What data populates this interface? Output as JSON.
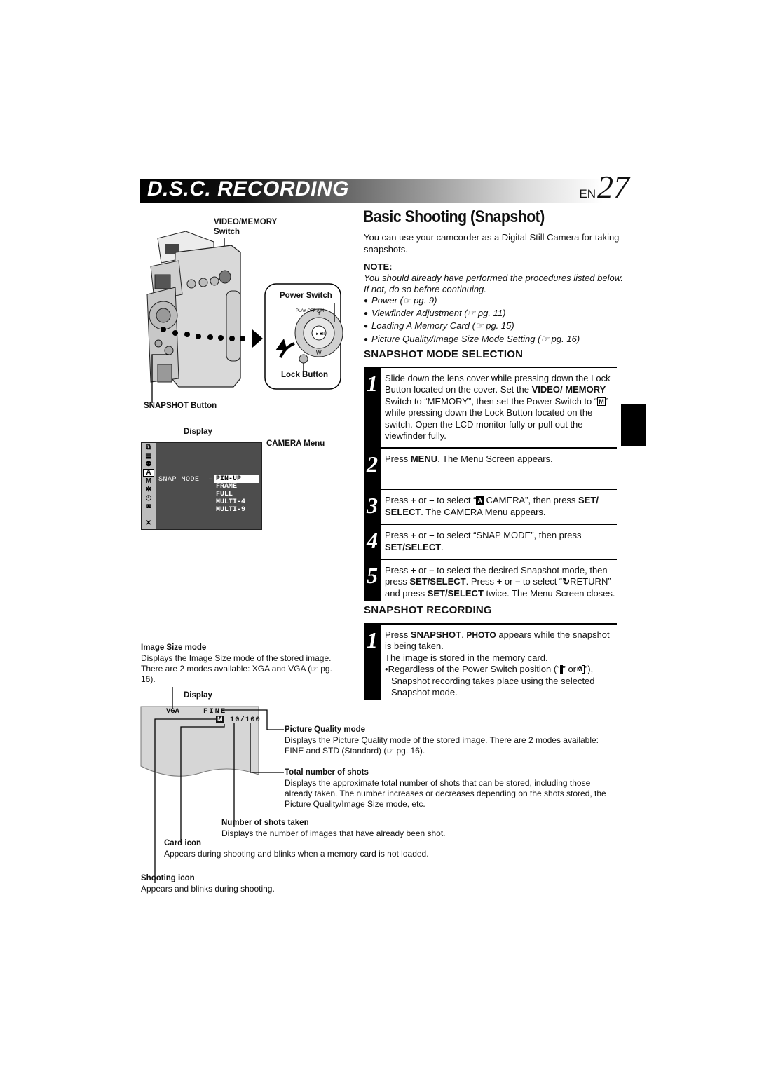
{
  "header": {
    "section_title": "D.S.C. RECORDING",
    "page_prefix": "EN",
    "page_number": "27"
  },
  "page_title": "Basic Shooting (Snapshot)",
  "intro": "You can use your camcorder as a Digital Still Camera for taking snapshots.",
  "note": {
    "heading": "NOTE:",
    "text": "You should already have performed the procedures listed below. If not, do so before continuing.",
    "items": [
      {
        "label": "Power",
        "ref": "pg. 9"
      },
      {
        "label": "Viewfinder Adjustment",
        "ref": "pg. 11"
      },
      {
        "label": "Loading A Memory Card",
        "ref": "pg. 15"
      },
      {
        "label": "Picture Quality/Image Size Mode Setting",
        "ref": "pg. 16"
      }
    ]
  },
  "mode_selection": {
    "heading": "SNAPSHOT MODE SELECTION",
    "steps": [
      {
        "num": "1",
        "parts": [
          "Slide down the lens cover while pressing down the Lock Button located on the cover. Set the ",
          "VIDEO/ MEMORY",
          " Switch to “MEMORY”, then set the Power Switch to “",
          "M",
          "” while pressing down the Lock Button located on the switch. Open the LCD monitor fully or pull out the viewfinder fully."
        ]
      },
      {
        "num": "2",
        "parts": [
          "Press ",
          "MENU",
          ". The Menu Screen appears."
        ]
      },
      {
        "num": "3",
        "parts": [
          "Press ",
          "+",
          " or ",
          "–",
          " to select “",
          "A",
          " CAMERA”, then press ",
          "SET/ SELECT",
          ". The CAMERA Menu appears."
        ]
      },
      {
        "num": "4",
        "parts": [
          "Press ",
          "+",
          " or ",
          "–",
          " to select “SNAP MODE”, then press ",
          "SET/SELECT",
          "."
        ]
      },
      {
        "num": "5",
        "parts": [
          "Press ",
          "+",
          " or ",
          "–",
          " to select the desired Snapshot mode, then press ",
          "SET/SELECT",
          ". Press ",
          "+",
          " or ",
          "–",
          " to select “",
          "↻",
          "RETURN” and press ",
          "SET/SELECT",
          " twice. The Menu Screen closes."
        ]
      }
    ]
  },
  "recording": {
    "heading": "SNAPSHOT RECORDING",
    "step": {
      "num": "1",
      "line1_pre": "Press ",
      "line1_bold": "SNAPSHOT",
      "line1_mid": ". ",
      "line1_photo": "PHOTO",
      "line1_post": " appears while the snapshot is being taken.",
      "line2": "The image is stored in the memory card.",
      "bullet_pre": "Regardless of the Power Switch position (“",
      "bullet_icon_a": "A",
      "bullet_mid": "” or “",
      "bullet_icon_m": "M",
      "bullet_post": "”), Snapshot recording takes place using the selected Snapshot mode."
    }
  },
  "illustration": {
    "video_memory_label_1": "VIDEO/MEMORY",
    "video_memory_label_2": "Switch",
    "power_switch_label": "Power Switch",
    "lock_button_label": "Lock Button",
    "snapshot_button_label": "SNAPSHOT Button",
    "dial_marks": [
      "PLAY",
      "OFF",
      "A",
      "M",
      "T",
      "W"
    ]
  },
  "camera_menu_display": {
    "display_label": "Display",
    "menu_caption": "CAMERA Menu",
    "side_icons": [
      "wipe",
      "program-ae",
      "exposure",
      "A",
      "M",
      "dsc",
      "clock",
      "camera",
      "",
      "X"
    ],
    "item_label": "SNAP MODE",
    "dash": "–",
    "options": [
      "PIN-UP",
      "FRAME",
      "FULL",
      "MULTI-4",
      "MULTI-9"
    ],
    "selected_option": "PIN-UP"
  },
  "status_display": {
    "image_size_heading": "Image Size mode",
    "image_size_desc": "Displays the Image Size mode of the stored image. There are 2 modes available: XGA and VGA (☞ pg. 16).",
    "display_label": "Display",
    "size_value": "VGA",
    "quality_value": "FINE",
    "shots": "10/100",
    "card_icon": "M",
    "callouts": [
      {
        "heading": "Picture Quality mode",
        "desc": "Displays the Picture Quality mode of the stored image. There are 2 modes available: FINE and STD (Standard) (☞ pg. 16)."
      },
      {
        "heading": "Total number of shots",
        "desc": "Displays the approximate total number of shots that can be stored, including those already taken. The number increases or decreases depending on the shots stored, the Picture Quality/Image Size mode, etc."
      },
      {
        "heading": "Number of shots taken",
        "desc": "Displays the number of images that have already been shot."
      },
      {
        "heading": "Card icon",
        "desc": "Appears during shooting and blinks when a memory card is not loaded."
      },
      {
        "heading": "Shooting icon",
        "desc": "Appears and blinks during shooting."
      }
    ]
  }
}
